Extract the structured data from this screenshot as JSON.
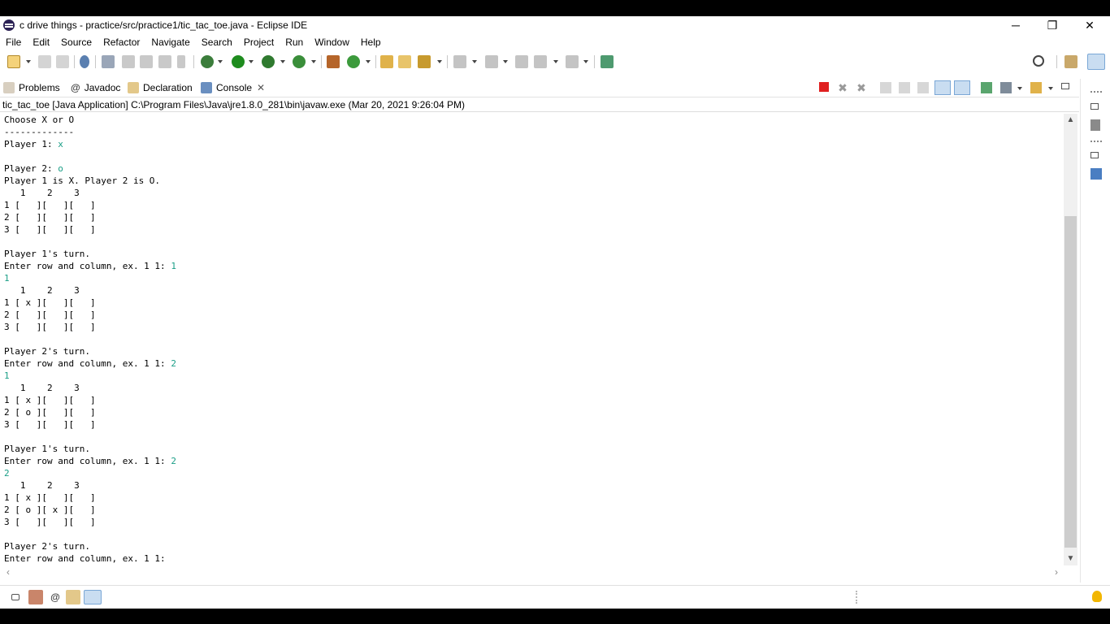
{
  "window": {
    "title": "c drive things - practice/src/practice1/tic_tac_toe.java - Eclipse IDE",
    "controls": {
      "minimize": "─",
      "restore": "❐",
      "close": "✕"
    }
  },
  "menu": [
    "File",
    "Edit",
    "Source",
    "Refactor",
    "Navigate",
    "Search",
    "Project",
    "Run",
    "Window",
    "Help"
  ],
  "views": {
    "tabs": [
      {
        "label": "Problems",
        "icon": "problems-icon"
      },
      {
        "label": "Javadoc",
        "icon": "javadoc-icon"
      },
      {
        "label": "Declaration",
        "icon": "declaration-icon"
      },
      {
        "label": "Console",
        "icon": "console-icon",
        "active": true
      }
    ],
    "close_glyph": "✕"
  },
  "console": {
    "launch": "tic_tac_toe [Java Application] C:\\Program Files\\Java\\jre1.8.0_281\\bin\\javaw.exe  (Mar 20, 2021 9:26:04 PM)",
    "lines": [
      [
        {
          "t": "Choose X or O"
        }
      ],
      [
        {
          "t": "-------------"
        }
      ],
      [
        {
          "t": "Player 1: "
        },
        {
          "t": "x",
          "input": true
        }
      ],
      [
        {
          "t": ""
        }
      ],
      [
        {
          "t": "Player 2: "
        },
        {
          "t": "o",
          "input": true
        }
      ],
      [
        {
          "t": "Player 1 is X. Player 2 is O."
        }
      ],
      [
        {
          "t": "   1    2    3"
        }
      ],
      [
        {
          "t": "1 [   ][   ][   ]"
        }
      ],
      [
        {
          "t": "2 [   ][   ][   ]"
        }
      ],
      [
        {
          "t": "3 [   ][   ][   ]"
        }
      ],
      [
        {
          "t": ""
        }
      ],
      [
        {
          "t": "Player 1's turn."
        }
      ],
      [
        {
          "t": "Enter row and column, ex. 1 1: "
        },
        {
          "t": "1",
          "input": true
        }
      ],
      [
        {
          "t": "1",
          "input": true
        }
      ],
      [
        {
          "t": "   1    2    3"
        }
      ],
      [
        {
          "t": "1 [ x ][   ][   ]"
        }
      ],
      [
        {
          "t": "2 [   ][   ][   ]"
        }
      ],
      [
        {
          "t": "3 [   ][   ][   ]"
        }
      ],
      [
        {
          "t": ""
        }
      ],
      [
        {
          "t": "Player 2's turn."
        }
      ],
      [
        {
          "t": "Enter row and column, ex. 1 1: "
        },
        {
          "t": "2",
          "input": true
        }
      ],
      [
        {
          "t": "1",
          "input": true
        }
      ],
      [
        {
          "t": "   1    2    3"
        }
      ],
      [
        {
          "t": "1 [ x ][   ][   ]"
        }
      ],
      [
        {
          "t": "2 [ o ][   ][   ]"
        }
      ],
      [
        {
          "t": "3 [   ][   ][   ]"
        }
      ],
      [
        {
          "t": ""
        }
      ],
      [
        {
          "t": "Player 1's turn."
        }
      ],
      [
        {
          "t": "Enter row and column, ex. 1 1: "
        },
        {
          "t": "2",
          "input": true
        }
      ],
      [
        {
          "t": "2",
          "input": true
        }
      ],
      [
        {
          "t": "   1    2    3"
        }
      ],
      [
        {
          "t": "1 [ x ][   ][   ]"
        }
      ],
      [
        {
          "t": "2 [ o ][ x ][   ]"
        }
      ],
      [
        {
          "t": "3 [   ][   ][   ]"
        }
      ],
      [
        {
          "t": ""
        }
      ],
      [
        {
          "t": "Player 2's turn."
        }
      ],
      [
        {
          "t": "Enter row and column, ex. 1 1: "
        }
      ]
    ]
  },
  "colors": {
    "input_text": "#1a9e86",
    "terminate_red": "#e02020",
    "run_green": "#1e8c1e",
    "tip_yellow": "#f2b600"
  }
}
